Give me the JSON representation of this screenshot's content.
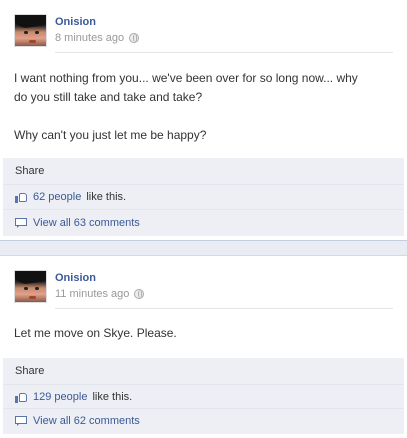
{
  "posts": [
    {
      "author": "Onision",
      "time": "8 minutes ago",
      "message_lines": [
        "I want nothing from you... we've been over for so long now... why",
        "do you still take and take and take?",
        "",
        "Why can't you just let me be happy?"
      ],
      "share_label": "Share",
      "likes_count": "62 people",
      "likes_suffix": "like this.",
      "comments_label": "View all 63 comments"
    },
    {
      "author": "Onision",
      "time": "11 minutes ago",
      "message_lines": [
        "Let me move on Skye. Please."
      ],
      "share_label": "Share",
      "likes_count": "129 people",
      "likes_suffix": "like this.",
      "comments_label": "View all 62 comments"
    }
  ],
  "colors": {
    "link": "#3b5998",
    "ufi_bg": "#edeff4",
    "meta": "#999999"
  }
}
